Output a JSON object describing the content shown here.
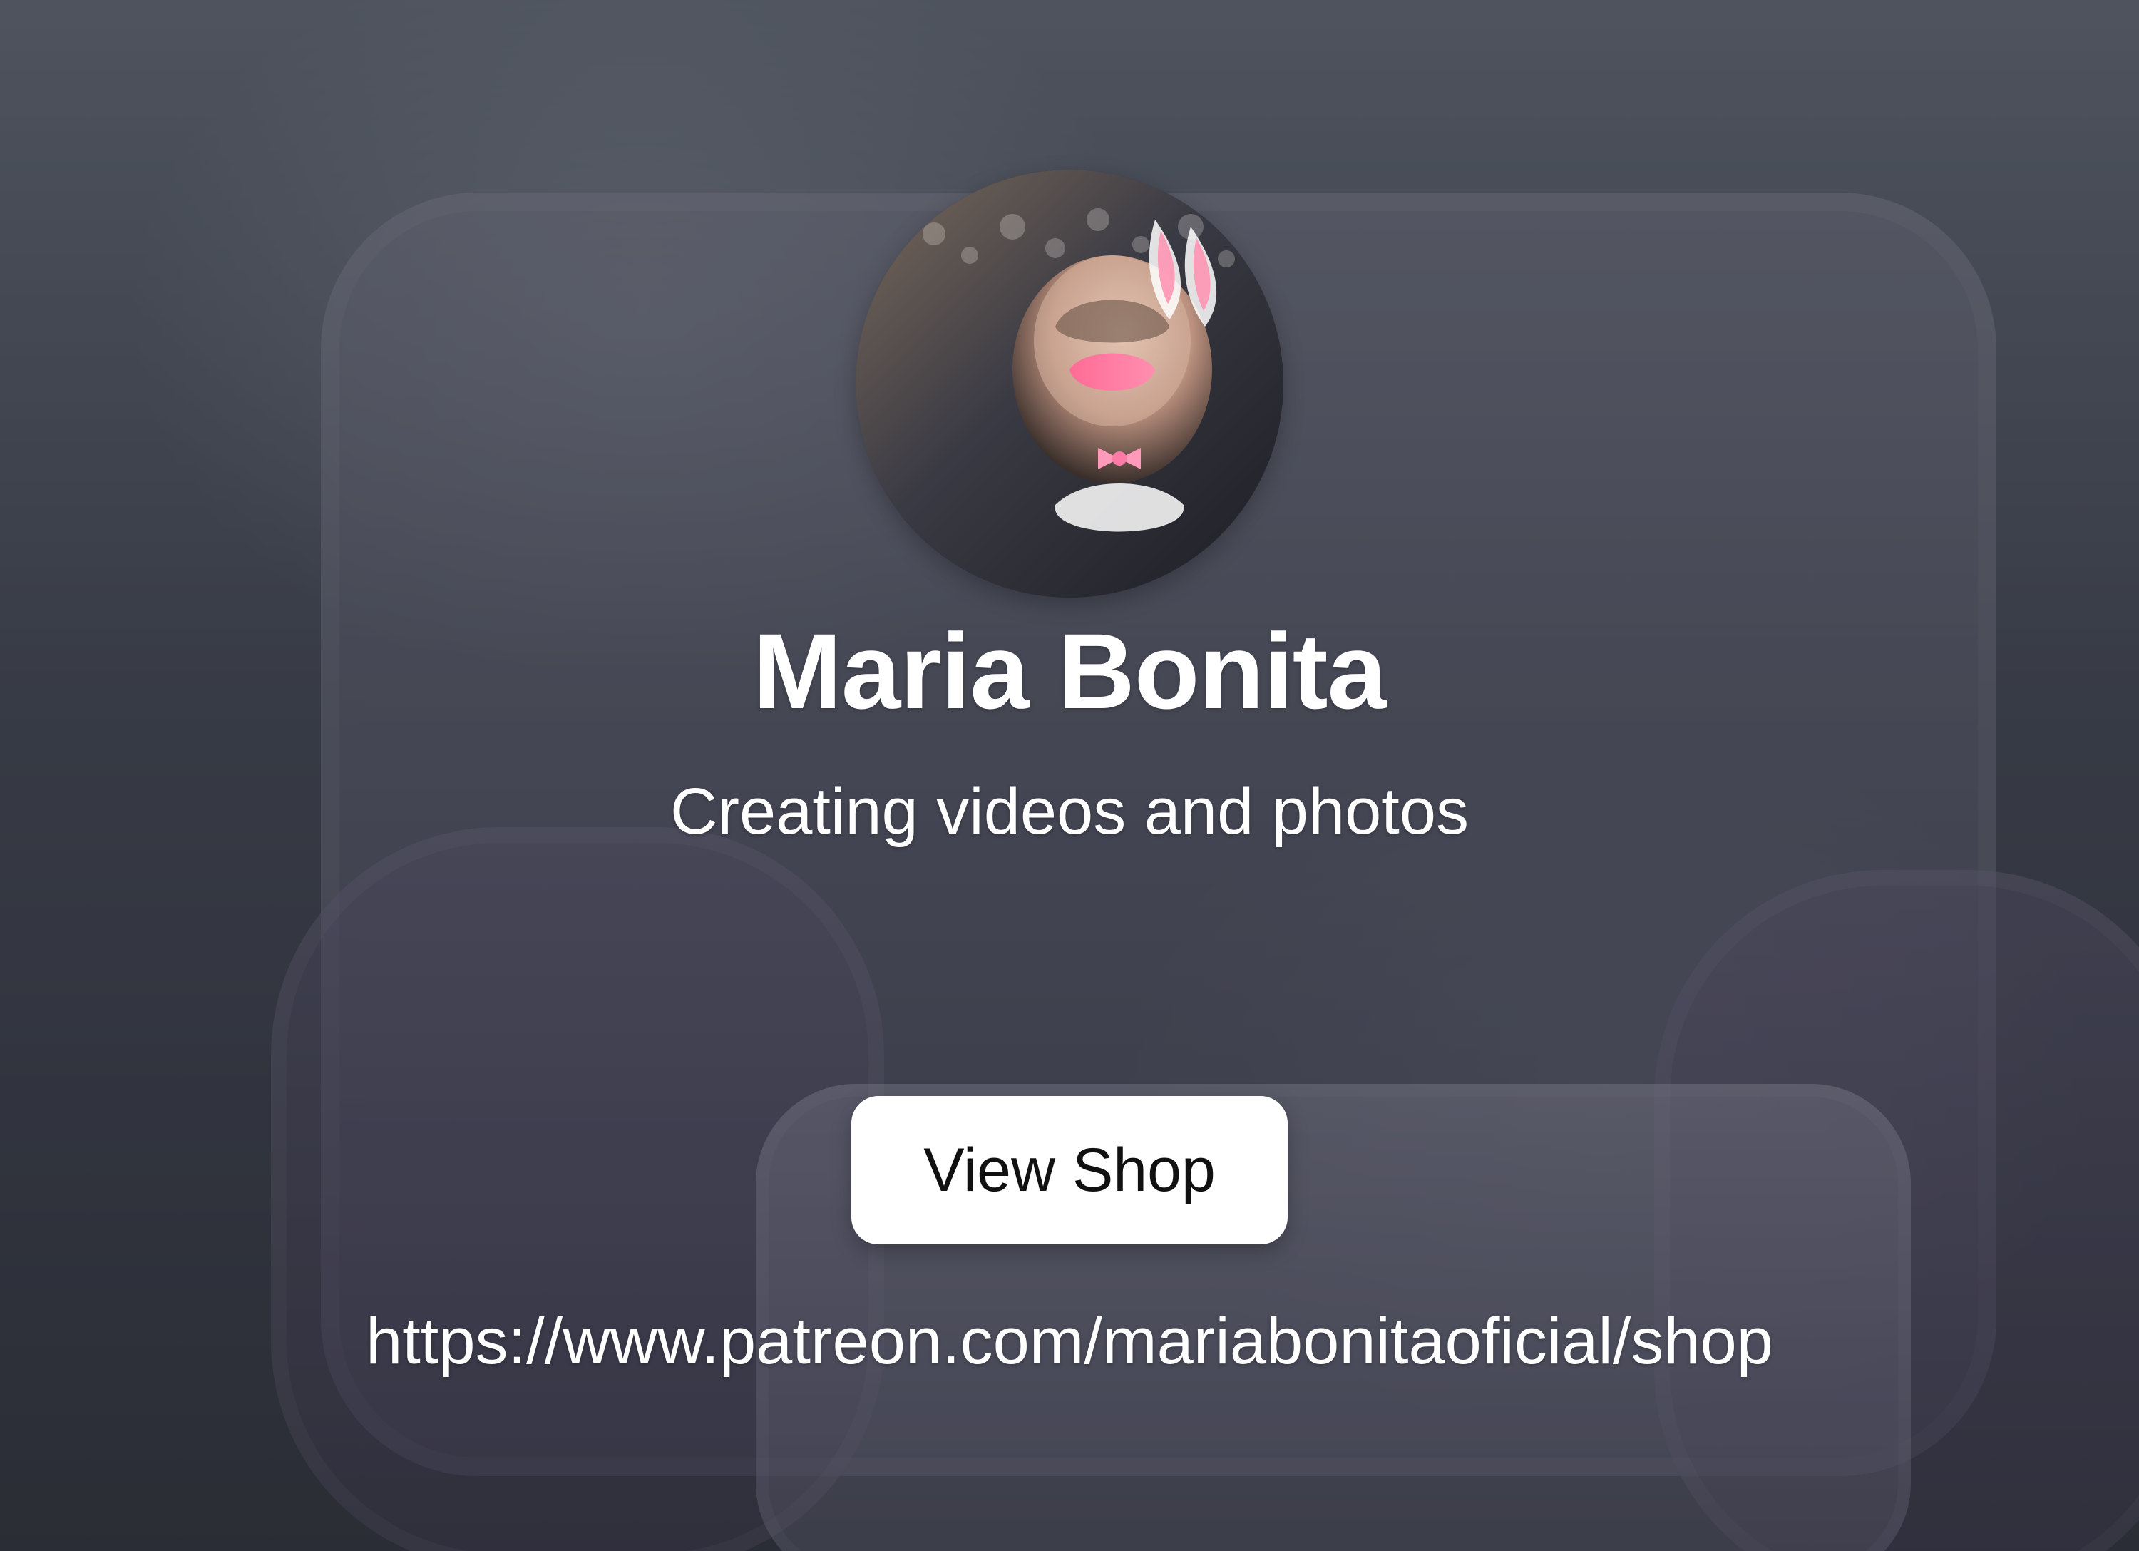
{
  "profile": {
    "name": "Maria Bonita",
    "tagline": "Creating videos and photos",
    "avatar_icon": "profile-photo-icon"
  },
  "actions": {
    "view_shop_label": "View Shop"
  },
  "links": {
    "shop_url_text": "https://www.patreon.com/mariabonitaoficial/shop"
  },
  "colors": {
    "button_bg": "#ffffff",
    "text_primary": "#ffffff",
    "button_text": "#111111"
  }
}
